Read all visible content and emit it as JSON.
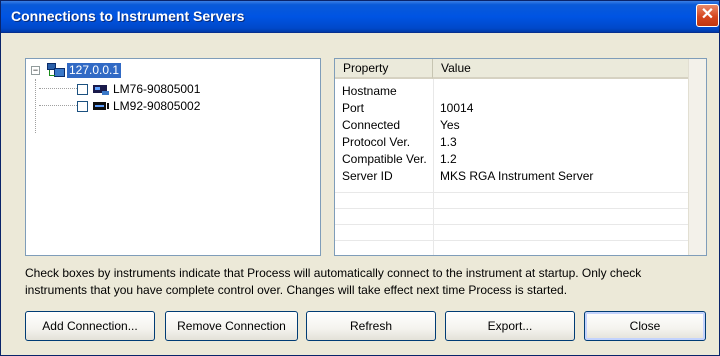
{
  "window": {
    "title": "Connections to Instrument Servers",
    "close_glyph": "✕"
  },
  "tree": {
    "root": {
      "label": "127.0.0.1",
      "expanded": true,
      "expander_glyph": "−",
      "icon": "network-icon"
    },
    "instruments": [
      {
        "label": "LM76-90805001",
        "checked": false,
        "icon": "instrument-icon"
      },
      {
        "label": "LM92-90805002",
        "checked": false,
        "icon": "instrument-icon"
      }
    ]
  },
  "properties": {
    "headers": {
      "property": "Property",
      "value": "Value"
    },
    "rows": [
      {
        "property": "Hostname",
        "value": ""
      },
      {
        "property": "Port",
        "value": "10014"
      },
      {
        "property": "Connected",
        "value": "Yes"
      },
      {
        "property": "Protocol Ver.",
        "value": "1.3"
      },
      {
        "property": "Compatible Ver.",
        "value": "1.2"
      },
      {
        "property": "Server ID",
        "value": "MKS RGA Instrument Server"
      }
    ]
  },
  "info_text": "Check boxes by instruments indicate that Process will automatically connect to the instrument at startup. Only check instruments that you have complete control over. Changes will take effect next time Process is started.",
  "buttons": {
    "add": "Add Connection...",
    "remove": "Remove Connection",
    "refresh": "Refresh",
    "export": "Export...",
    "close": "Close"
  },
  "colors": {
    "titlebar": "#0054e3",
    "selection": "#316ac5",
    "dialog_bg": "#ece9d8",
    "close_button": "#d6461f"
  }
}
